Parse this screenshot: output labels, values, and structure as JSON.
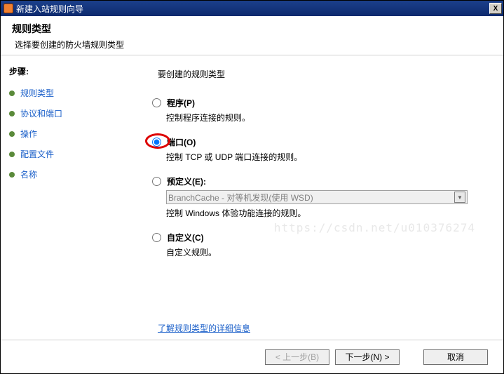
{
  "titlebar": {
    "title": "新建入站规则向导",
    "close": "X"
  },
  "header": {
    "title": "规则类型",
    "subtitle": "选择要创建的防火墙规则类型"
  },
  "sidebar": {
    "steps_label": "步骤:",
    "items": [
      {
        "label": "规则类型"
      },
      {
        "label": "协议和端口"
      },
      {
        "label": "操作"
      },
      {
        "label": "配置文件"
      },
      {
        "label": "名称"
      }
    ]
  },
  "content": {
    "prompt": "要创建的规则类型",
    "options": {
      "program": {
        "label": "程序(P)",
        "desc": "控制程序连接的规则。"
      },
      "port": {
        "label": "端口(O)",
        "desc": "控制 TCP 或 UDP 端口连接的规则。"
      },
      "predefined": {
        "label": "预定义(E):",
        "desc": "控制 Windows 体验功能连接的规则。",
        "dropdown": "BranchCache - 对等机发现(使用 WSD)"
      },
      "custom": {
        "label": "自定义(C)",
        "desc": "自定义规则。"
      }
    },
    "learn_more": "了解规则类型的详细信息",
    "watermark": "https://csdn.net/u010376274"
  },
  "footer": {
    "back": "< 上一步(B)",
    "next": "下一步(N) >",
    "cancel": "取消"
  }
}
